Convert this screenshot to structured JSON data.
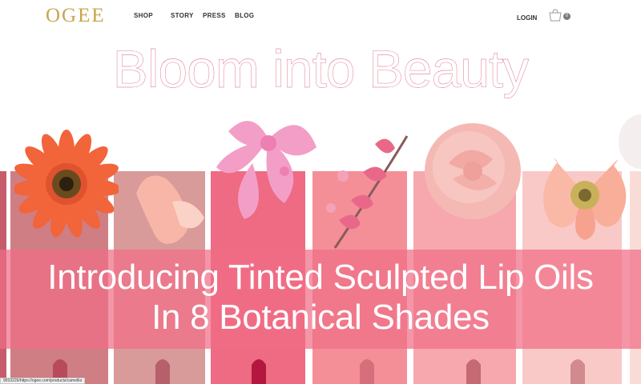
{
  "header": {
    "logo": "OGEE",
    "nav": [
      "SHOP",
      "STORY",
      "PRESS",
      "BLOG"
    ],
    "login": "LOGIN",
    "cart_count": "0"
  },
  "hero": {
    "headline": "Bloom into Beauty",
    "banner_line1": "Introducing Tinted Sculpted Lip Oils",
    "banner_line2": "In 8 Botanical Shades"
  },
  "status_bar": {
    "url": "9910226/https://ogee.com/products/camellia"
  },
  "colors": {
    "logo_gold": "#c9a44c",
    "headline_pink": "#d6607a",
    "banner_pink": "#f06e87"
  },
  "icons": {
    "cart": "shopping-bag-icon"
  }
}
